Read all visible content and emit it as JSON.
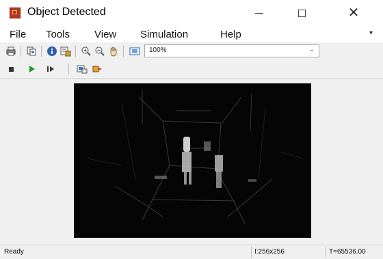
{
  "window": {
    "title": "Object Detected"
  },
  "menu": {
    "file": "File",
    "tools": "Tools",
    "view": "View",
    "simulation": "Simulation",
    "help": "Help"
  },
  "toolbar": {
    "zoom": "100%",
    "icons": [
      "print-icon",
      "copy-icon",
      "info-icon",
      "properties-icon",
      "zoom-in-icon",
      "zoom-out-icon",
      "pan-icon",
      "fit-to-window-icon",
      "stop-icon",
      "run-icon",
      "step-forward-icon",
      "snapshot-icon",
      "highlight-block-icon"
    ]
  },
  "status": {
    "ready": "Ready",
    "size": "I:256x256",
    "time": "T=65536.00"
  },
  "colors": {
    "accent_green": "#1a9a2a",
    "app_icon": "#b5361c",
    "image_bg": "#050505"
  }
}
